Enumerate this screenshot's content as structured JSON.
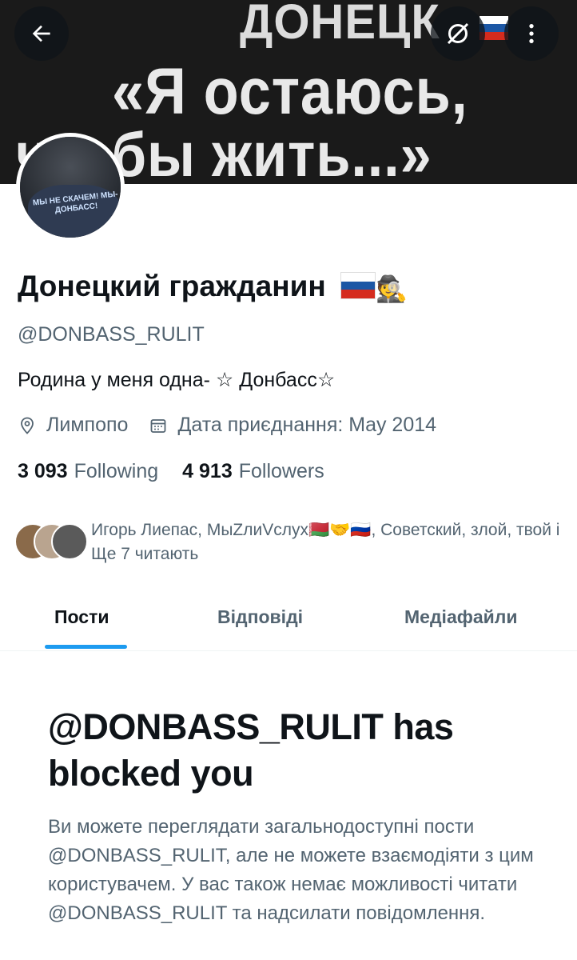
{
  "banner": {
    "line1": "ДОНЕЦК",
    "line2": "«Я остаюсь,",
    "line3": "чтобы жить...»"
  },
  "toolbar": {
    "back_icon": "arrow-left-icon",
    "translate_icon": "translate-icon",
    "more_icon": "more-vertical-icon"
  },
  "avatar": {
    "shirt_text": "МЫ НЕ СКАЧЕМ! МЫ-ДОНБАСС!"
  },
  "profile": {
    "display_name": "Донецкий гражданин",
    "handle": "@DONBASS_RULIT",
    "bio": "Родина у меня одна- ☆ Донбасс☆",
    "location": "Лимпопо",
    "joined": "Дата приєднання: May 2014",
    "following_count": "3 093",
    "following_label": "Following",
    "followers_count": "4 913",
    "followers_label": "Followers",
    "followed_by_text": "Игорь Лиепас, МыZлиVслух🇧🇾🤝🇷🇺, Советский, злой, твой і Ще 7 читають"
  },
  "tabs": [
    {
      "label": "Пости",
      "active": true
    },
    {
      "label": "Відповіді",
      "active": false
    },
    {
      "label": "Медіафайли",
      "active": false
    }
  ],
  "blocked": {
    "title": "@DONBASS_RULIT has blocked you",
    "description": "Ви можете переглядати загальнодоступні пости @DONBASS_RULIT, але не можете взаємодіяти з цим користувачем. У вас також немає можливості читати @DONBASS_RULIT та надсилати повідомлення."
  },
  "colors": {
    "accent": "#1d9bf0",
    "text_primary": "#0f1419",
    "text_secondary": "#536471"
  }
}
